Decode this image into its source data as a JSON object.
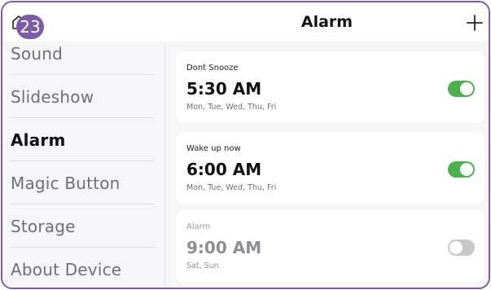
{
  "badge": {
    "count": "23"
  },
  "header": {
    "title": "Alarm"
  },
  "sidebar": {
    "items": [
      {
        "label": "Sound",
        "active": false
      },
      {
        "label": "Slideshow",
        "active": false
      },
      {
        "label": "Alarm",
        "active": true
      },
      {
        "label": "Magic Button",
        "active": false
      },
      {
        "label": "Storage",
        "active": false
      },
      {
        "label": "About Device",
        "active": false
      }
    ]
  },
  "alarms": [
    {
      "label": "Dont Snooze",
      "time": "5:30 AM",
      "days": "Mon, Tue, Wed, Thu, Fri",
      "enabled": true
    },
    {
      "label": "Wake up now",
      "time": "6:00 AM",
      "days": "Mon, Tue, Wed, Thu, Fri",
      "enabled": true
    },
    {
      "label": "Alarm",
      "time": "9:00 AM",
      "days": "Sat, Sun",
      "enabled": false
    }
  ],
  "colors": {
    "accent": "#7b5aa6",
    "toggle_on": "#4cb050",
    "toggle_off": "#c8c8cc"
  },
  "icons": {
    "home": "home-icon",
    "add": "plus-icon"
  }
}
